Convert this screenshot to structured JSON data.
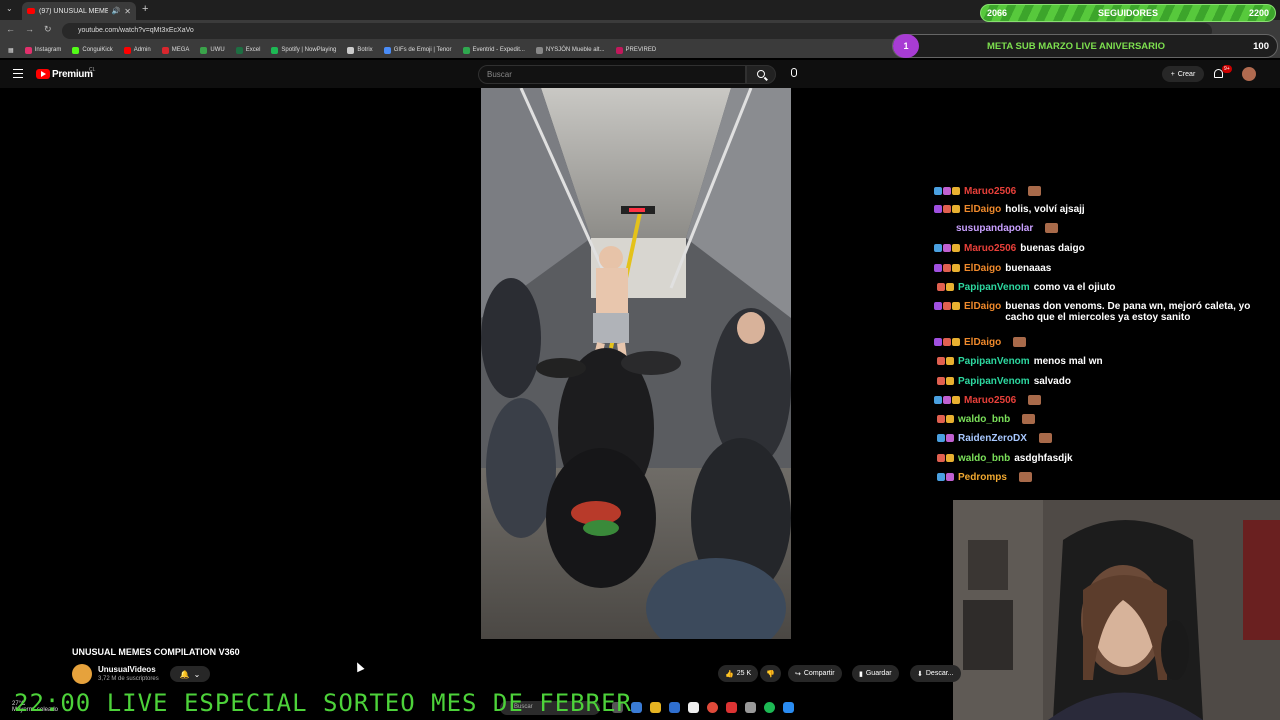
{
  "browser": {
    "tab_title": "(97) UNUSUAL MEMES CO...",
    "url": "youtube.com/watch?v=qMt3xEcXaVo",
    "bookmarks": [
      {
        "label": "Instagram",
        "color": "#e1306c"
      },
      {
        "label": "ConguiKick",
        "color": "#53fc18"
      },
      {
        "label": "Admin",
        "color": "#ff0000"
      },
      {
        "label": "MEGA",
        "color": "#d9272e"
      },
      {
        "label": "UWU",
        "color": "#3aa34a"
      },
      {
        "label": "Excel",
        "color": "#1d6f42"
      },
      {
        "label": "Spotify | NowPlaying",
        "color": "#1db954"
      },
      {
        "label": "Botrix",
        "color": "#cccccc"
      },
      {
        "label": "GIFs de Emoji | Tenor",
        "color": "#4a8cf7"
      },
      {
        "label": "Eventrid - Expedit...",
        "color": "#2fa84f"
      },
      {
        "label": "NYSJÓN Mueble alt...",
        "color": "#888888"
      },
      {
        "label": "PREVIRED",
        "color": "#c2185b"
      }
    ]
  },
  "youtube": {
    "brand": "Premium",
    "country": "CL",
    "search_placeholder": "Buscar",
    "create_label": "Crear",
    "notif_count": "9+"
  },
  "video": {
    "title": "UNUSUAL MEMES COMPILATION V360",
    "channel": "UnusualVideos",
    "subscribers": "3,72 M de suscriptores",
    "likes": "25 K",
    "share_label": "Compartir",
    "save_label": "Guardar",
    "download_label": "Descar..."
  },
  "overlay": {
    "followers_current": "2066",
    "followers_label": "SEGUIDORES",
    "followers_goal": "2200",
    "followers_progress": 0.93,
    "goal_number": "1",
    "goal_label": "META SUB MARZO LIVE ANIVERSARIO",
    "goal_value": "100",
    "ticker": "22:00 LIVE ESPECIAL SORTEO MES DE FEBRER"
  },
  "chat": [
    {
      "user": "Maruo2506",
      "color": "#e8403a",
      "message": "",
      "emote": true,
      "badges": [
        "#4aa0e0",
        "#c060d0",
        "#e8b030"
      ]
    },
    {
      "user": "ElDaigo",
      "color": "#f08a2c",
      "message": "holis, volví ajsajj",
      "emote": false,
      "badges": [
        "#a050e0",
        "#e06050",
        "#e8b030"
      ]
    },
    {
      "user": "susupandapolar",
      "color": "#c9a0ff",
      "message": "",
      "emote": true,
      "badges": []
    },
    {
      "user": "Maruo2506",
      "color": "#e8403a",
      "message": "buenas daigo",
      "emote": false,
      "badges": [
        "#4aa0e0",
        "#c060d0",
        "#e8b030"
      ]
    },
    {
      "user": "ElDaigo",
      "color": "#f08a2c",
      "message": "buenaaas",
      "emote": false,
      "badges": [
        "#a050e0",
        "#e06050",
        "#e8b030"
      ]
    },
    {
      "user": "PapipanVenom",
      "color": "#2dd8a0",
      "message": "como va el ojiuto",
      "emote": false,
      "badges": [
        "#e06050",
        "#e8b030"
      ]
    },
    {
      "user": "ElDaigo",
      "color": "#f08a2c",
      "message": "buenas don venoms. De pana wn, mejoró caleta, yo",
      "message2": "cacho que el miercoles ya estoy sanito",
      "emote": false,
      "badges": [
        "#a050e0",
        "#e06050",
        "#e8b030"
      ]
    },
    {
      "user": "ElDaigo",
      "color": "#f08a2c",
      "message": "",
      "emote": true,
      "badges": [
        "#a050e0",
        "#e06050",
        "#e8b030"
      ]
    },
    {
      "user": "PapipanVenom",
      "color": "#2dd8a0",
      "message": "menos mal wn",
      "emote": false,
      "badges": [
        "#e06050",
        "#e8b030"
      ]
    },
    {
      "user": "PapipanVenom",
      "color": "#2dd8a0",
      "message": "salvado",
      "emote": false,
      "badges": [
        "#e06050",
        "#e8b030"
      ]
    },
    {
      "user": "Maruo2506",
      "color": "#e8403a",
      "message": "",
      "emote": true,
      "badges": [
        "#4aa0e0",
        "#c060d0",
        "#e8b030"
      ]
    },
    {
      "user": "waldo_bnb",
      "color": "#7be05a",
      "message": "",
      "emote": true,
      "badges": [
        "#e06050",
        "#e8b030"
      ]
    },
    {
      "user": "RaidenZeroDX",
      "color": "#a8c8ff",
      "message": "",
      "emote": true,
      "badges": [
        "#4aa0e0",
        "#c060d0"
      ]
    },
    {
      "user": "waldo_bnb",
      "color": "#7be05a",
      "message": "asdghfasdjk",
      "emote": false,
      "badges": [
        "#e06050",
        "#e8b030"
      ]
    },
    {
      "user": "Pedromps",
      "color": "#f0a830",
      "message": "",
      "emote": true,
      "badges": [
        "#4aa0e0",
        "#c060d0"
      ]
    }
  ],
  "taskbar": {
    "weather": "27°C",
    "weather_desc": "Mayorm. soleado",
    "search_placeholder": "Buscar"
  }
}
